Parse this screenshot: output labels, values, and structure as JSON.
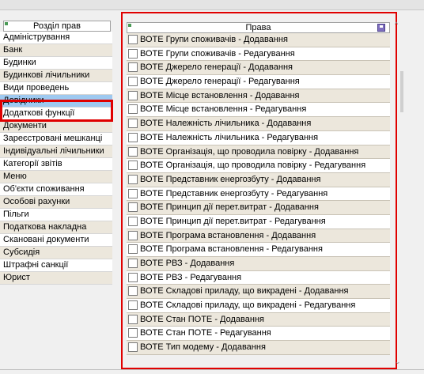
{
  "categories": {
    "header": "Розділ прав",
    "items": [
      "Адміністрування",
      "Банк",
      "Будинки",
      "Будинкові лічильники",
      "Види проведень",
      "Довідники",
      "Додаткові функції",
      "Документи",
      "Зареєстровані мешканці",
      "Індивідуальні лічильники",
      "Категорії звітів",
      "Меню",
      "Об'єкти споживання",
      "Особові рахунки",
      "Пільги",
      "Податкова накладна",
      "Скановані документи",
      "Субсидія",
      "Штрафні санкції",
      "Юрист"
    ],
    "selected": "Довідники"
  },
  "rights": {
    "header": "Права",
    "items": [
      "ВОТЕ Групи споживачів - Додавання",
      "ВОТЕ Групи споживачів - Редагування",
      "ВОТЕ Джерело генерації - Додавання",
      "ВОТЕ Джерело генерації - Редагування",
      "ВОТЕ Місце встановлення - Додавання",
      "ВОТЕ Місце встановлення - Редагування",
      "ВОТЕ Належність лічильника - Додавання",
      "ВОТЕ Належність лічильника - Редагування",
      "ВОТЕ Організація, що проводила повірку - Додавання",
      "ВОТЕ Організація, що проводила повірку - Редагування",
      "ВОТЕ Представник енергозбуту - Додавання",
      "ВОТЕ Представник енергозбуту - Редагування",
      "ВОТЕ Принцип дії перет.витрат - Додавання",
      "ВОТЕ Принцип дії перет.витрат - Редагування",
      "ВОТЕ Програма встановлення - Додавання",
      "ВОТЕ Програма встановлення - Редагування",
      "ВОТЕ РВЗ - Додавання",
      "ВОТЕ РВЗ - Редагування",
      "ВОТЕ Складові приладу, що викрадені - Додавання",
      "ВОТЕ Складові приладу, що викрадені - Редагування",
      "ВОТЕ Стан ПОТЕ - Додавання",
      "ВОТЕ Стан ПОТЕ - Редагування",
      "ВОТЕ Тип модему - Додавання"
    ]
  },
  "icons": {
    "save": "save-icon",
    "scroll_up": "chevron-up-icon",
    "scroll_down": "chevron-down-icon"
  },
  "colors": {
    "highlight": "#e00000",
    "selected_row": "#9ec9f0",
    "alt_row": "#ece7dc"
  }
}
